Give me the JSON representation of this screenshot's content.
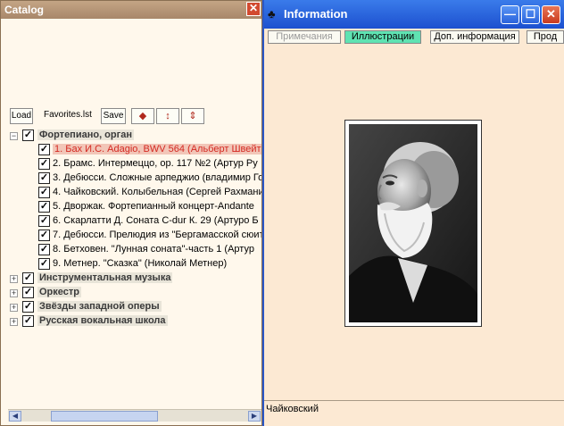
{
  "catalog": {
    "title": "Catalog",
    "close": "✕",
    "toolbar": {
      "load": "Load",
      "file": "Favorites.lst",
      "save": "Save"
    },
    "categories": [
      {
        "label": "Фортепиано, орган",
        "expanded": true,
        "checked": true
      },
      {
        "label": "Инструментальная музыка",
        "expanded": false,
        "checked": true
      },
      {
        "label": "Оркестр",
        "expanded": false,
        "checked": true
      },
      {
        "label": "Звёзды западной оперы",
        "expanded": false,
        "checked": true
      },
      {
        "label": "Русская вокальная школа",
        "expanded": false,
        "checked": true
      }
    ],
    "items": [
      "1. Бах И.С. Adagio, BWV 564 (Альберт Швейт",
      "2. Брамс. Интермеццо, ор. 117 №2 (Артур Ру",
      "3. Дебюсси. Сложные арпеджио (владимир Го",
      "4. Чайковский. Колыбельная (Сергей Рахмани",
      "5. Дворжак. Фортепианный концерт-Andante",
      "6. Скарлатти Д. Соната C-dur К. 29 (Артуро Б",
      "7. Дебюсси. Прелюдия из \"Бергамасской сюит",
      "8. Бетховен. \"Лунная соната\"-часть 1 (Артур",
      "9. Метнер. \"Сказка\" (Николай Метнер)"
    ],
    "selected_index": 0
  },
  "info": {
    "title": "Information",
    "buttons": {
      "minimize": "—",
      "maximize": "☐",
      "close": "✕"
    },
    "tabs": [
      "Примечания",
      "Иллюстрации",
      "Доп. информация",
      "Прод"
    ],
    "active_tab": 1,
    "caption": "Чайковский"
  },
  "colors": {
    "selected_text": "#d42a22",
    "active_tab": "#5fe3b2",
    "titlebar_blue": "#1c50cf"
  }
}
